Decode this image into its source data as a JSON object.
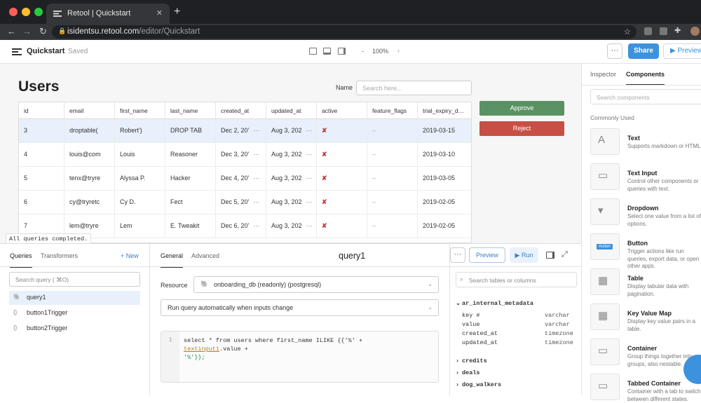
{
  "browser": {
    "tab_title": "Retool | Quickstart",
    "close_icon": "close-icon",
    "url_host": "isidentsu.retool.com",
    "url_path": "/editor/Quickstart"
  },
  "app": {
    "name": "Quickstart",
    "status": "Saved",
    "zoom_minus": "-",
    "zoom": "100%",
    "zoom_plus": "+",
    "more_label": "···",
    "share_label": "Share",
    "preview_label": "Preview"
  },
  "canvas": {
    "title": "Users",
    "name_label": "Name",
    "name_placeholder": "Search here...",
    "approve_label": "Approve",
    "reject_label": "Reject",
    "status_text": "All queries completed."
  },
  "table": {
    "columns": [
      "id",
      "email",
      "first_name",
      "last_name",
      "created_at",
      "updated_at",
      "active",
      "feature_flags",
      "trial_expiry_d…"
    ],
    "rows": [
      [
        "3",
        "droptable(",
        "Robert')",
        "DROP TAB",
        "Dec 2, 20'",
        "Aug 3, 202",
        "✘",
        "–",
        "2019-03-15"
      ],
      [
        "4",
        "louis@com",
        "Louis",
        "Reasoner",
        "Dec 3, 20'",
        "Aug 3, 202",
        "✘",
        "–",
        "2019-03-10"
      ],
      [
        "5",
        "tenx@tryre",
        "Alyssa P.",
        "Hacker",
        "Dec 4, 20'",
        "Aug 3, 202",
        "✘",
        "–",
        "2019-03-05"
      ],
      [
        "6",
        "cy@tryretc",
        "Cy D.",
        "Fect",
        "Dec 5, 20'",
        "Aug 3, 202",
        "✘",
        "–",
        "2019-02-05"
      ],
      [
        "7",
        "lem@tryre",
        "Lem",
        "E. Tweakit",
        "Dec 6, 20'",
        "Aug 3, 202",
        "✘",
        "–",
        "2019-02-05"
      ]
    ],
    "ellipsis": "···"
  },
  "right_panel": {
    "tab_inspector": "Inspector",
    "tab_components": "Components",
    "search_placeholder": "Search components",
    "section": "Commonly Used",
    "components": [
      {
        "title": "Text",
        "desc": "Supports markdown or HTML"
      },
      {
        "title": "Text Input",
        "desc": "Control other components or queries with text."
      },
      {
        "title": "Dropdown",
        "desc": "Select one value from a list of options."
      },
      {
        "title": "Button",
        "desc": "Trigger actions like run queries, export data, or open other apps."
      },
      {
        "title": "Table",
        "desc": "Display tabular data with pagination."
      },
      {
        "title": "Key Value Map",
        "desc": "Display key value pairs in a table."
      },
      {
        "title": "Container",
        "desc": "Group things together into groups, also nestable."
      },
      {
        "title": "Tabbed Container",
        "desc": "Container with a tab to switch between different states."
      }
    ],
    "button_badge": "Action"
  },
  "queries": {
    "tab_queries": "Queries",
    "tab_transformers": "Transformers",
    "new_label": "+ New",
    "search_placeholder": "Search query ( ⌘O)",
    "items": [
      "query1",
      "button1Trigger",
      "button2Trigger"
    ]
  },
  "editor": {
    "tab_general": "General",
    "tab_advanced": "Advanced",
    "query_name": "query1",
    "more_label": "···",
    "preview_label": "Preview",
    "run_label": "Run",
    "resource_label": "Resource",
    "resource_value": "onboarding_db (readonly) (postgresql)",
    "trigger_value": "Run query automatically when inputs change",
    "line_number": "1",
    "code_p1": "select * from users where first_name ILIKE {{'%' + ",
    "code_var": "textinput1",
    "code_p2": ".value + ",
    "code_p3": "'%'}};"
  },
  "schema": {
    "search_placeholder": "Search tables or columns",
    "open_table": "ar_internal_metadata",
    "columns": [
      {
        "name": "key #",
        "type": "varchar"
      },
      {
        "name": "value",
        "type": "varchar"
      },
      {
        "name": "created_at",
        "type": "timezone"
      },
      {
        "name": "updated_at",
        "type": "timezone"
      }
    ],
    "tables": [
      "credits",
      "deals",
      "dog_walkers"
    ]
  }
}
